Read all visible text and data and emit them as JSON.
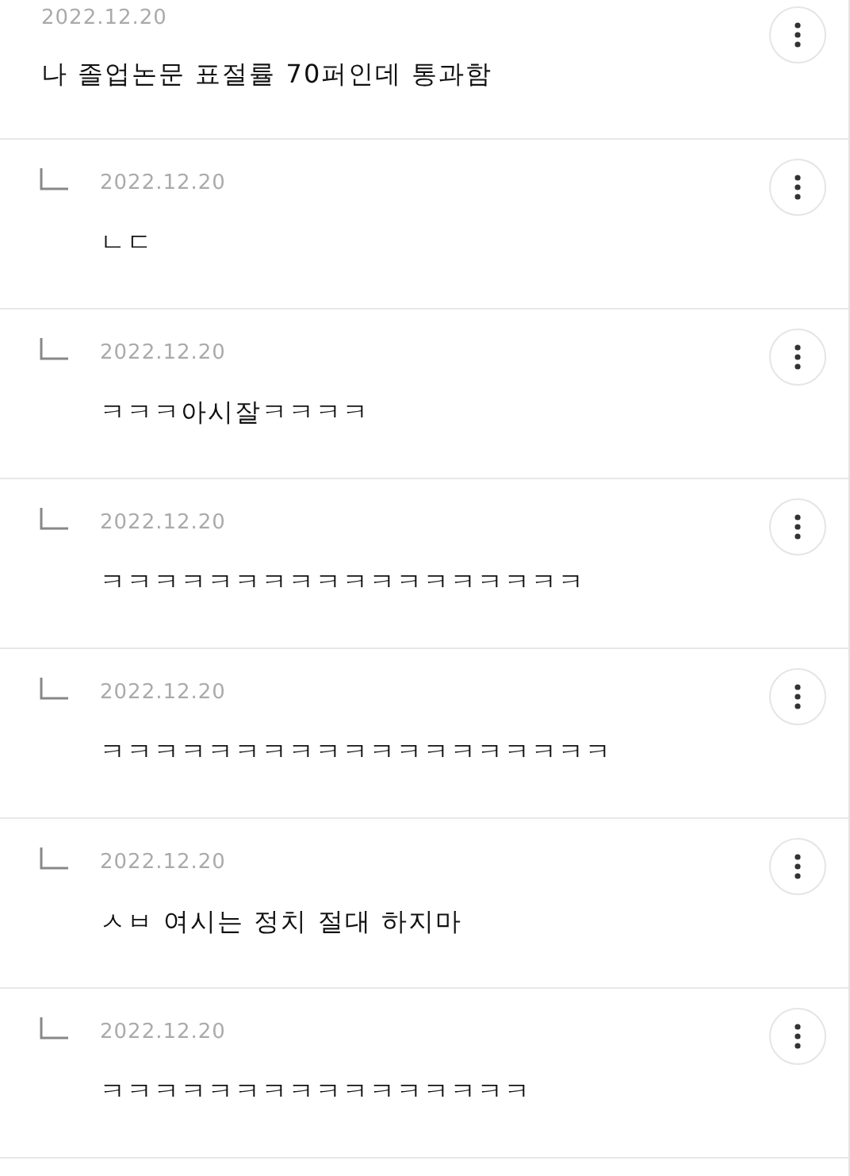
{
  "comment": {
    "date": "2022.12.20",
    "text": "나 졸업논문 표절률 70퍼인데 통과함"
  },
  "replies": [
    {
      "date": "2022.12.20",
      "text": "ㄴㄷ"
    },
    {
      "date": "2022.12.20",
      "text": "ㅋㅋㅋ아시잘ㅋㅋㅋㅋ"
    },
    {
      "date": "2022.12.20",
      "text": "ㅋㅋㅋㅋㅋㅋㅋㅋㅋㅋㅋㅋㅋㅋㅋㅋㅋㅋ"
    },
    {
      "date": "2022.12.20",
      "text": "ㅋㅋㅋㅋㅋㅋㅋㅋㅋㅋㅋㅋㅋㅋㅋㅋㅋㅋㅋ"
    },
    {
      "date": "2022.12.20",
      "text": "ㅅㅂ 여시는 정치 절대 하지마"
    },
    {
      "date": "2022.12.20",
      "text": "ㅋㅋㅋㅋㅋㅋㅋㅋㅋㅋㅋㅋㅋㅋㅋㅋ"
    }
  ]
}
